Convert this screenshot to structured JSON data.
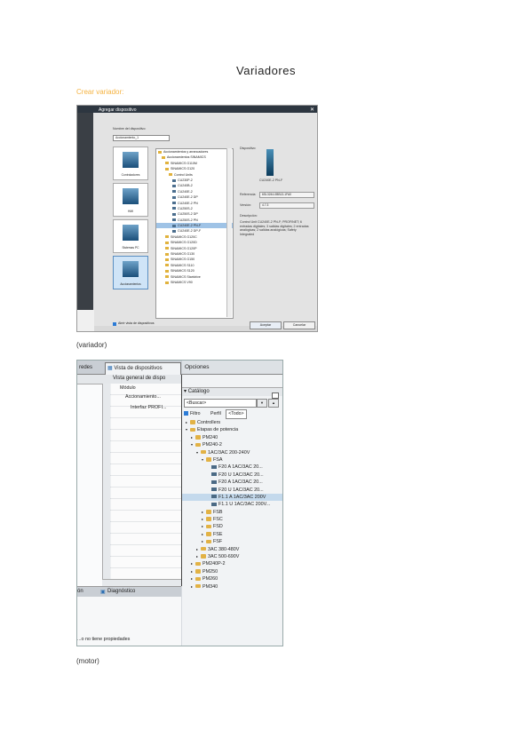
{
  "page": {
    "title": "Variadores",
    "link_text": "Crear variador:",
    "caption_1": "(variador)",
    "caption_2": "(motor)"
  },
  "colors": {
    "link": "#f5b342",
    "accent": "#2c7bd6",
    "dialog_title_bg": "#2d3640"
  },
  "dialog": {
    "title": "Agregar dispositivo",
    "name_label": "Nombre del dispositivo:",
    "name_value": "Accionamiento_1",
    "categories": [
      "Controladores",
      "HMI",
      "Sistemas PC",
      "Accionamientos"
    ],
    "tree": [
      "Accionamientos y arrancadores",
      "Accionamientos SINAMICS",
      "SINAMICS G110M",
      "SINAMICS G120",
      "Control Units",
      "CU230P-2",
      "CU240B-2",
      "CU240E-2",
      "CU240E-2 DP",
      "CU240E-2 PN",
      "CU250S-2",
      "CU250S-2 DP",
      "CU250S-2 PN",
      "CU240E-2 PN-F",
      "CU240E-2 DP-F",
      "SINAMICS G120C",
      "SINAMICS G120D",
      "SINAMICS G120P",
      "SINAMICS G130",
      "SINAMICS G150",
      "SINAMICS S110",
      "SINAMICS S120",
      "SINAMICS Startdrive",
      "SINAMICS V90"
    ],
    "info": {
      "device_label": "Dispositivo:",
      "device_name": "CU240E-2 PN-F",
      "ref_label": "Referencia:",
      "ref_value": "6SL3244-0BB13-1FA0",
      "version_label": "Versión:",
      "version_value": "4.7.3",
      "desc_label": "Descripción:",
      "desc_text": "Control Unit CU240E-2 PN-F; PROFINET; 6 entradas digitales; 3 salidas digitales; 2 entradas analógicas; 2 salidas analógicas; Safety Integrated"
    },
    "open_view_label": "Abrir vista de dispositivos",
    "ok_label": "Aceptar",
    "cancel_label": "Cancelar"
  },
  "tia": {
    "tabs": [
      "redes",
      "Vista de dispositivos"
    ],
    "options_label": "Opciones",
    "subheader": "Vista general de dispo",
    "grid_header": "Módulo",
    "grid_rows": [
      "Accionamiento...",
      "Interfaz PROFI..."
    ],
    "bottom_tabs": [
      "ón",
      "Diagnóstico"
    ],
    "no_props": "...o no tiene propiedades",
    "catalog_label": "Catálogo",
    "search_placeholder": "<Buscar>",
    "filter_label": "Filtro",
    "profile_label": "Perfil",
    "profile_value": "<Todo>",
    "catalog_tree": [
      {
        "label": "Controllers",
        "level": 0,
        "icon": "folder",
        "open": false
      },
      {
        "label": "Etapas de potencia",
        "level": 0,
        "icon": "folder",
        "open": true
      },
      {
        "label": "PM240",
        "level": 1,
        "icon": "folder",
        "open": false
      },
      {
        "label": "PM240-2",
        "level": 1,
        "icon": "folder",
        "open": true
      },
      {
        "label": "1AC/3AC 200-240V",
        "level": 2,
        "icon": "folder",
        "open": true
      },
      {
        "label": "FSA",
        "level": 3,
        "icon": "folder",
        "open": true
      },
      {
        "label": "F20 A 1AC/3AC 20...",
        "level": 4,
        "icon": "module"
      },
      {
        "label": "F20 U 1AC/3AC 20...",
        "level": 4,
        "icon": "module"
      },
      {
        "label": "F20 A 1AC/3AC 20...",
        "level": 4,
        "icon": "module"
      },
      {
        "label": "F20 U 1AC/3AC 20...",
        "level": 4,
        "icon": "module"
      },
      {
        "label": "F1.1 A 1AC/3AC 200V",
        "level": 4,
        "icon": "module",
        "selected": true
      },
      {
        "label": "F1.1 U 1AC/3AC 200V...",
        "level": 4,
        "icon": "module"
      },
      {
        "label": "FSB",
        "level": 3,
        "icon": "folder",
        "open": false
      },
      {
        "label": "FSC",
        "level": 3,
        "icon": "folder",
        "open": false
      },
      {
        "label": "FSD",
        "level": 3,
        "icon": "folder",
        "open": false
      },
      {
        "label": "FSE",
        "level": 3,
        "icon": "folder",
        "open": false
      },
      {
        "label": "FSF",
        "level": 3,
        "icon": "folder",
        "open": false
      },
      {
        "label": "3AC 380-480V",
        "level": 2,
        "icon": "folder",
        "open": false
      },
      {
        "label": "3AC 500-690V",
        "level": 2,
        "icon": "folder",
        "open": false
      },
      {
        "label": "PM240P-2",
        "level": 1,
        "icon": "folder",
        "open": false
      },
      {
        "label": "PM250",
        "level": 1,
        "icon": "folder",
        "open": false
      },
      {
        "label": "PM260",
        "level": 1,
        "icon": "folder",
        "open": false
      },
      {
        "label": "PM340",
        "level": 1,
        "icon": "folder",
        "open": false
      }
    ]
  }
}
